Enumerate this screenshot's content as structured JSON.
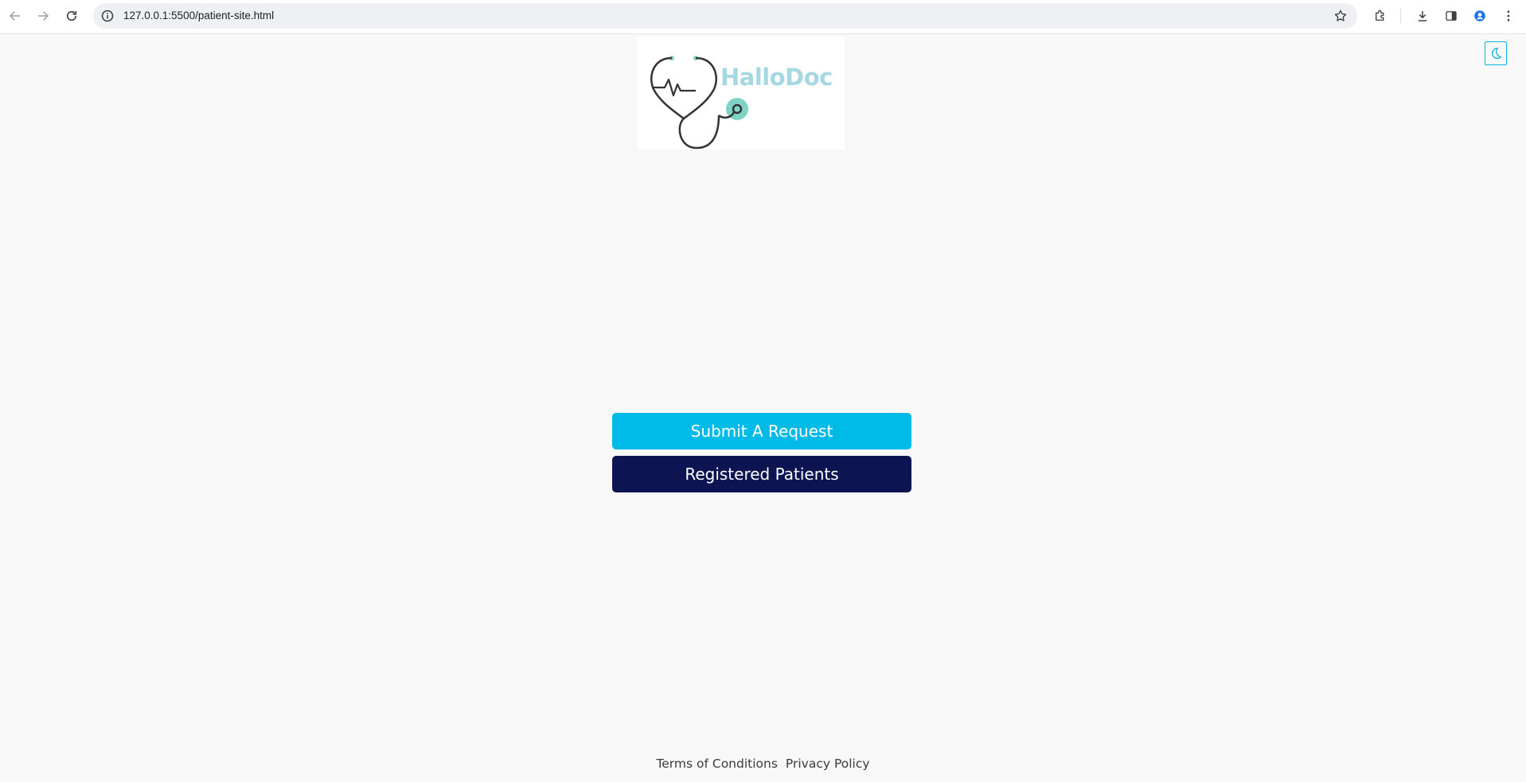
{
  "browser": {
    "url": "127.0.0.1:5500/patient-site.html"
  },
  "logo": {
    "text": "HalloDoc",
    "accent_color": "#7fd3c6",
    "text_color": "#a6d8e3"
  },
  "theme_toggle": {
    "icon": "moon-icon",
    "color": "#0bb7dc"
  },
  "actions": {
    "submit_label": "Submit A Request",
    "submit_color": "#00bbe7",
    "registered_label": "Registered Patients",
    "registered_color": "#0d1452"
  },
  "footer": {
    "terms_label": "Terms of Conditions",
    "privacy_label": "Privacy Policy"
  }
}
